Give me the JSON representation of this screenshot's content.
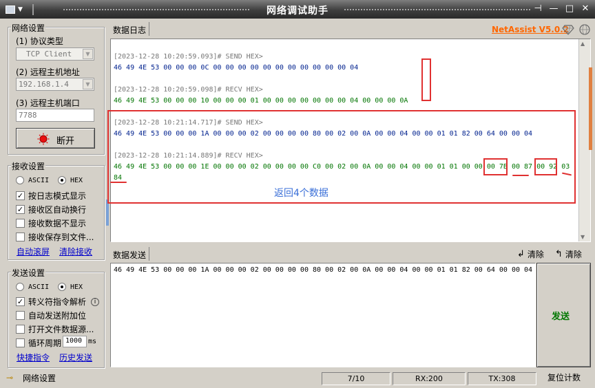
{
  "window": {
    "title": "网络调试助手",
    "brand": "NetAssist V5.0.2",
    "brand_color": "#ff6600",
    "pin_icon": "pin-icon",
    "minimize": "—",
    "maximize": "□",
    "close": "✕"
  },
  "network": {
    "group_title": "网络设置",
    "protocol_label": "(1) 协议类型",
    "protocol_value": "TCP Client",
    "host_label": "(2) 远程主机地址",
    "host_value": "192.168.1.4",
    "port_label": "(3) 远程主机端口",
    "port_value": "7788",
    "disconnect_label": "断开"
  },
  "receive": {
    "group_title": "接收设置",
    "ascii_label": "ASCII",
    "hex_label": "HEX",
    "options": [
      {
        "label": "按日志模式显示",
        "checked": true
      },
      {
        "label": "接收区自动换行",
        "checked": true
      },
      {
        "label": "接收数据不显示",
        "checked": false
      },
      {
        "label": "接收保存到文件...",
        "checked": false
      }
    ],
    "auto_clear": "自动滚屏",
    "clear_receive": "清除接收"
  },
  "send": {
    "group_title": "发送设置",
    "ascii_label": "ASCII",
    "hex_label": "HEX",
    "options": [
      {
        "label": "转义符指令解析",
        "checked": true
      },
      {
        "label": "自动发送附加位",
        "checked": false
      },
      {
        "label": "打开文件数据源...",
        "checked": false
      },
      {
        "label": "循环周期",
        "checked": false
      }
    ],
    "period_value": "1000",
    "period_unit": "ms",
    "shortcut": "快捷指令",
    "history": "历史发送"
  },
  "log": {
    "tab_label": "数据日志",
    "lines": [
      {
        "kind": "head",
        "text": "[2023-12-28 10:20:59.093]# SEND HEX>"
      },
      {
        "kind": "send",
        "text": "46 49 4E 53 00 00 00 0C 00 00 00 00 00 00 00 00 00 00 00 04"
      },
      {
        "kind": "blank",
        "text": ""
      },
      {
        "kind": "head",
        "text": "[2023-12-28 10:20:59.098]# RECV HEX>"
      },
      {
        "kind": "recv",
        "text": "46 49 4E 53 00 00 00 10 00 00 00 01 00 00 00 00 00 00 00 04 00 00 00 0A"
      },
      {
        "kind": "blank",
        "text": ""
      },
      {
        "kind": "head",
        "text": "[2023-12-28 10:21:14.717]# SEND HEX>"
      },
      {
        "kind": "send",
        "text": "46 49 4E 53 00 00 00 1A 00 00 00 02 00 00 00 00 80 00 02 00 0A 00 00 04 00 00 01 01 82 00 64 00 00 04"
      },
      {
        "kind": "blank",
        "text": ""
      },
      {
        "kind": "head",
        "text": "[2023-12-28 10:21:14.889]# RECV HEX>"
      },
      {
        "kind": "recv",
        "text": "46 49 4E 53 00 00 00 1E 00 00 00 02 00 00 00 00 C0 00 02 00 0A 00 00 04 00 00 01 01 00 00 00 7B 00 87 00 92 03"
      },
      {
        "kind": "recv",
        "text": "84"
      }
    ],
    "annotation": "返回4个数据",
    "annotation_color": "#3a6fd8",
    "highlight_color": "#e03030"
  },
  "send_area": {
    "tab_label": "数据发送",
    "clear_icon_label": "清除",
    "clear_all_label": "清除",
    "content": "46 49 4E 53 00 00 00 1A 00 00 00 02 00 00 00 00 80 00 02 00 0A 00 00 04 00 00 01 01 82 00 64 00 00 04",
    "send_button": "发送",
    "send_color": "#007700"
  },
  "status_bar": {
    "label": "网络设置",
    "count": "7/10",
    "rx": "RX:200",
    "tx": "TX:308",
    "reset": "复位计数"
  }
}
